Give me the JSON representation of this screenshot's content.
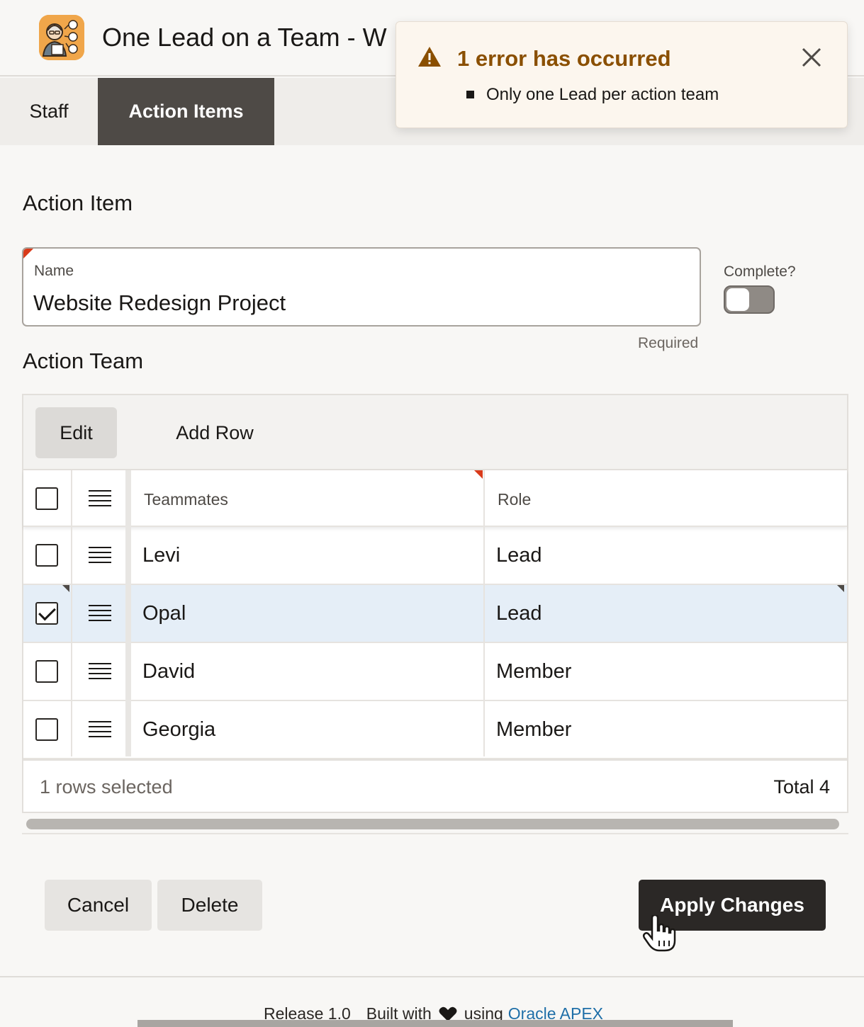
{
  "header": {
    "app_title": "One Lead on a Team  - W",
    "tabs": [
      {
        "label": "Staff"
      },
      {
        "label": "Action Items"
      }
    ]
  },
  "notification": {
    "title": "1 error has occurred",
    "messages": [
      "Only one Lead per action team"
    ],
    "accent_color": "#8a4f00"
  },
  "action_item": {
    "section_title": "Action Item",
    "name_label": "Name",
    "name_value": "Website Redesign Project",
    "required_note": "Required",
    "complete_label": "Complete?",
    "complete_value": false
  },
  "action_team": {
    "section_title": "Action Team",
    "toolbar": {
      "edit_label": "Edit",
      "add_row_label": "Add Row"
    },
    "columns": [
      "Teammates",
      "Role"
    ],
    "rows": [
      {
        "teammate": "Levi",
        "role": "Lead",
        "selected": false
      },
      {
        "teammate": "Opal",
        "role": "Lead",
        "selected": true
      },
      {
        "teammate": "David",
        "role": "Member",
        "selected": false
      },
      {
        "teammate": "Georgia",
        "role": "Member",
        "selected": false
      }
    ],
    "footer": {
      "selected_text": "1 rows selected",
      "total_text": "Total 4"
    }
  },
  "buttons": {
    "cancel": "Cancel",
    "delete": "Delete",
    "apply": "Apply Changes"
  },
  "footer": {
    "release": "Release 1.0",
    "built_with": "Built with",
    "using": "using",
    "link": "Oracle APEX"
  }
}
